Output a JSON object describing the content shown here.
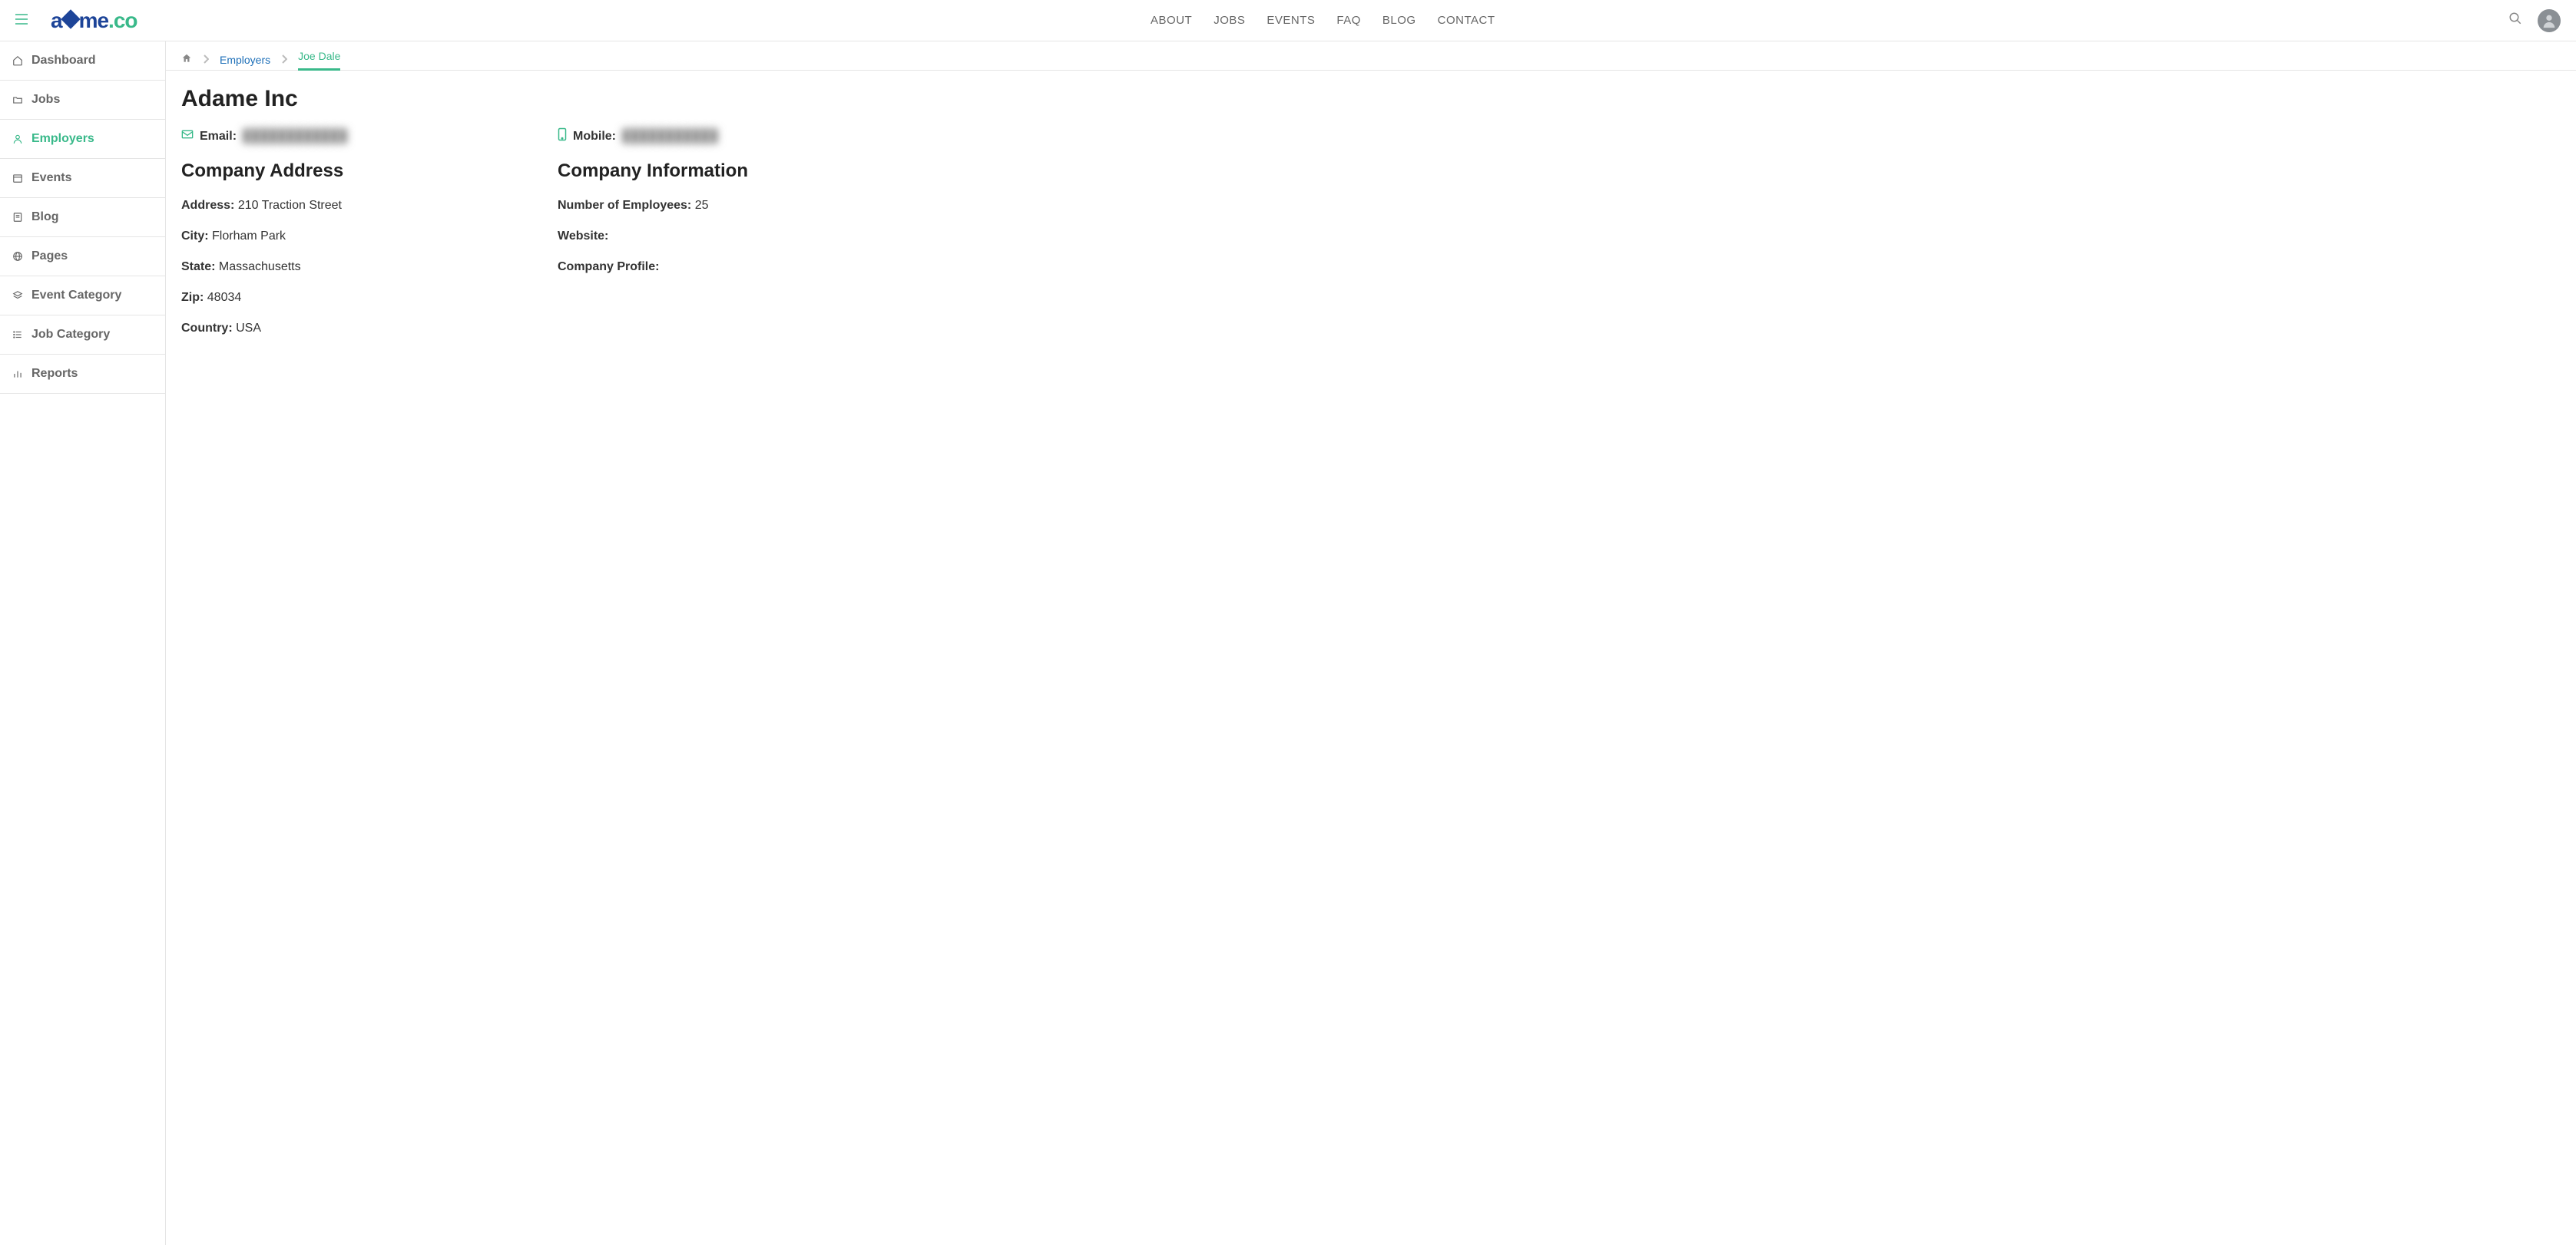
{
  "header": {
    "logo_text_a": "a",
    "logo_text_b": "me",
    "logo_text_c": ".co",
    "nav": [
      "ABOUT",
      "JOBS",
      "EVENTS",
      "FAQ",
      "BLOG",
      "CONTACT"
    ]
  },
  "sidebar": {
    "items": [
      {
        "label": "Dashboard"
      },
      {
        "label": "Jobs"
      },
      {
        "label": "Employers"
      },
      {
        "label": "Events"
      },
      {
        "label": "Blog"
      },
      {
        "label": "Pages"
      },
      {
        "label": "Event Category"
      },
      {
        "label": "Job Category"
      },
      {
        "label": "Reports"
      }
    ]
  },
  "breadcrumb": {
    "link1": "Employers",
    "current": "Joe Dale"
  },
  "page": {
    "title": "Adame Inc",
    "email_label": "Email:",
    "email_value": "████████████",
    "mobile_label": "Mobile:",
    "mobile_value": "███████████",
    "address_section_title": "Company Address",
    "info_section_title": "Company Information",
    "address": {
      "address_k": "Address:",
      "address_v": "210 Traction Street",
      "city_k": "City:",
      "city_v": "Florham Park",
      "state_k": "State:",
      "state_v": "Massachusetts",
      "zip_k": "Zip:",
      "zip_v": "48034",
      "country_k": "Country:",
      "country_v": "USA"
    },
    "info": {
      "employees_k": "Number of Employees:",
      "employees_v": "25",
      "website_k": "Website:",
      "website_v": "",
      "profile_k": "Company Profile:",
      "profile_v": ""
    }
  }
}
